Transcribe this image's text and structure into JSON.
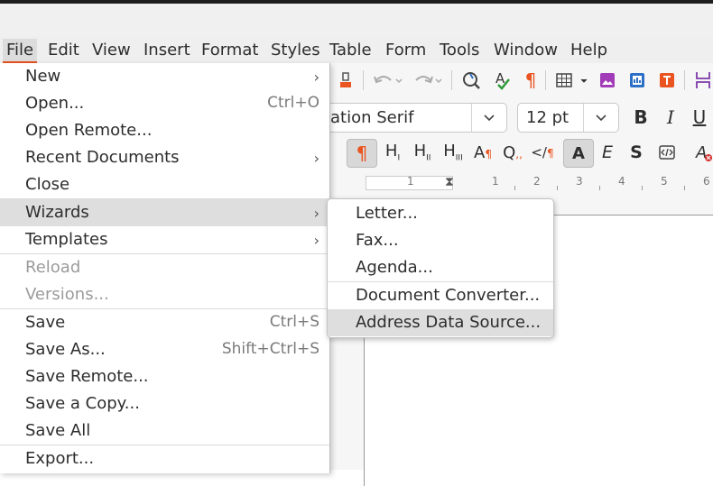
{
  "menubar": {
    "file": "File",
    "edit": "Edit",
    "view": "View",
    "insert": "Insert",
    "format": "Format",
    "styles": "Styles",
    "table": "Table",
    "form": "Form",
    "tools": "Tools",
    "window": "Window",
    "help": "Help"
  },
  "toolbar": {
    "font_name": "ation Serif",
    "font_size": "12 pt",
    "bold": "B",
    "italic": "I",
    "underline": "U",
    "text_a": "A",
    "text_e": "E",
    "text_s": "S",
    "ruler_numbers": [
      "1",
      "1",
      "2",
      "3",
      "4",
      "5",
      "6"
    ]
  },
  "file_menu": {
    "new": "New",
    "open": "Open...",
    "open_shortcut": "Ctrl+O",
    "open_remote": "Open Remote...",
    "recent_documents": "Recent Documents",
    "close": "Close",
    "wizards": "Wizards",
    "templates": "Templates",
    "reload": "Reload",
    "versions": "Versions...",
    "save": "Save",
    "save_shortcut": "Ctrl+S",
    "save_as": "Save As...",
    "save_as_shortcut": "Shift+Ctrl+S",
    "save_remote": "Save Remote...",
    "save_copy": "Save a Copy...",
    "save_all": "Save All",
    "export": "Export..."
  },
  "wizards_menu": {
    "letter": "Letter...",
    "fax": "Fax...",
    "agenda": "Agenda...",
    "document_converter": "Document Converter...",
    "address_data_source": "Address Data Source..."
  },
  "colors": {
    "accent": "#e95420",
    "highlight": "#dedede"
  }
}
